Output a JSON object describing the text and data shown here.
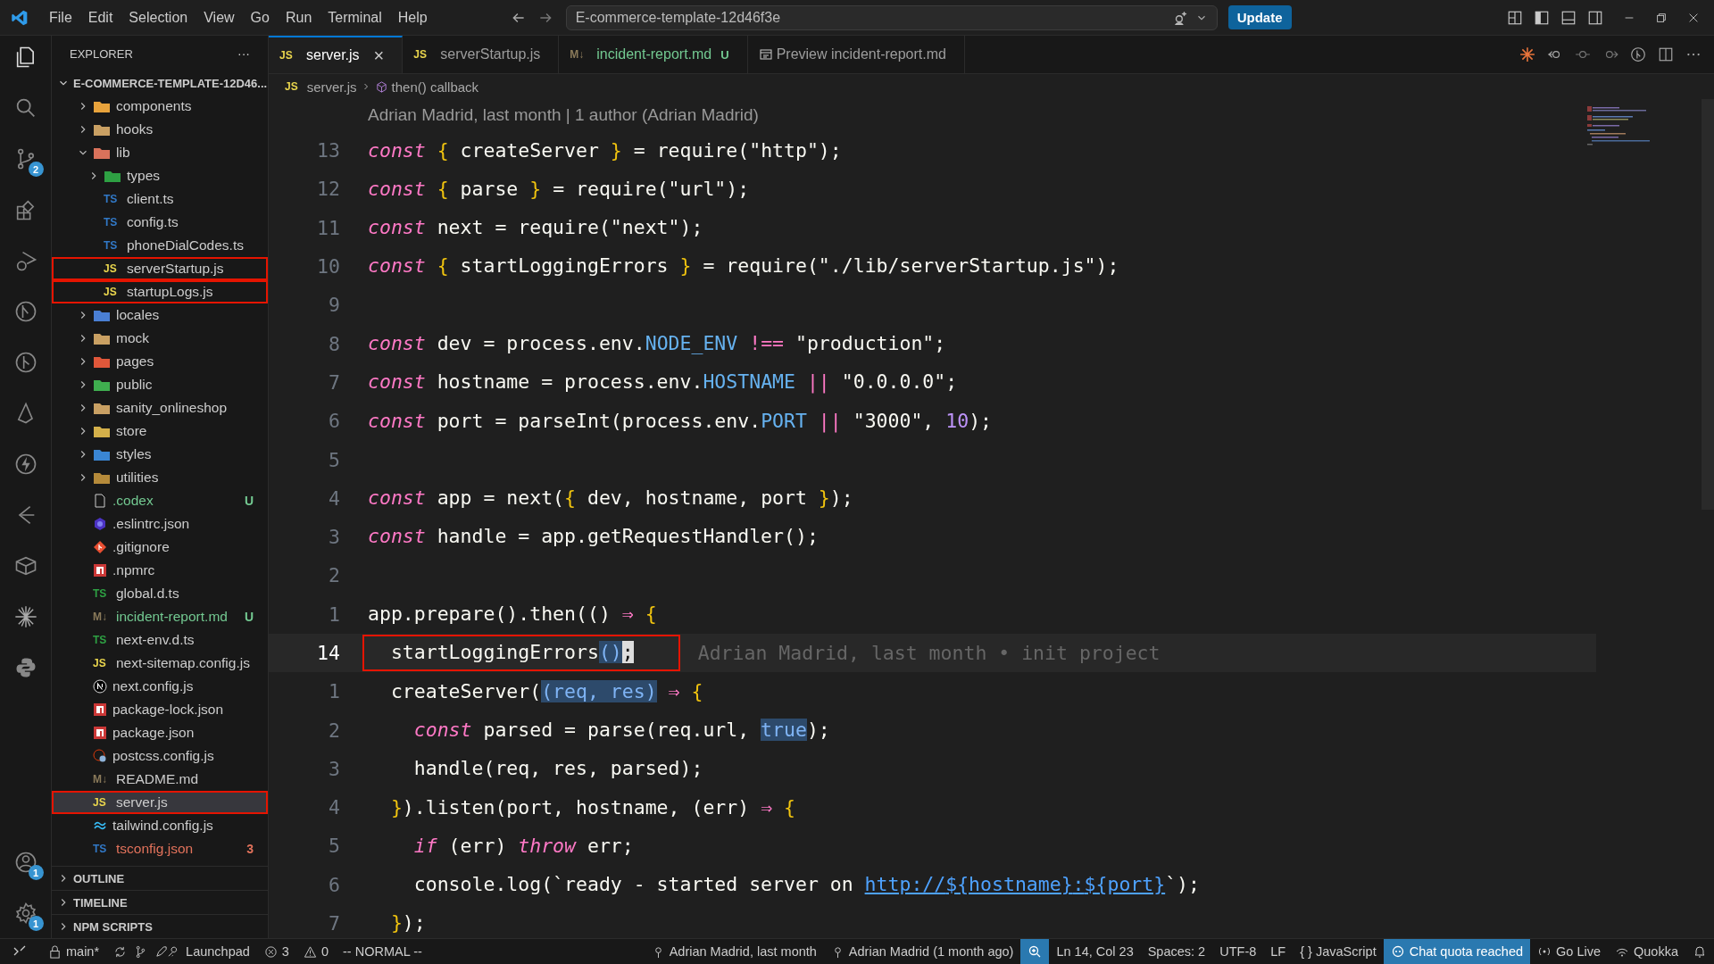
{
  "menu": [
    "File",
    "Edit",
    "Selection",
    "View",
    "Go",
    "Run",
    "Terminal",
    "Help"
  ],
  "command_center": {
    "value": "E-commerce-template-12d46f3e"
  },
  "update_button": "Update",
  "activity_bar": {
    "source_control_badge": "2",
    "accounts_badge": "1",
    "settings_badge": "1"
  },
  "explorer": {
    "title": "EXPLORER",
    "more": "···",
    "root": "E-COMMERCE-TEMPLATE-12D46...",
    "tree": [
      {
        "name": "components",
        "kind": "folder",
        "color": "#e8a33c",
        "expanded": false,
        "selected": false,
        "highlighted": false
      },
      {
        "name": "hooks",
        "kind": "folder",
        "color": "#c9a063",
        "expanded": false,
        "selected": false,
        "highlighted": false
      },
      {
        "name": "lib",
        "kind": "folder",
        "color": "#d9725b",
        "expanded": true,
        "selected": false,
        "highlighted": false,
        "children": [
          {
            "name": "types",
            "kind": "folder",
            "color": "#2ea043",
            "expanded": false,
            "selected": false,
            "highlighted": false
          },
          {
            "name": "client.ts",
            "kind": "ts",
            "icon": "TS",
            "selected": false,
            "highlighted": false
          },
          {
            "name": "config.ts",
            "kind": "ts",
            "icon": "TS",
            "selected": false,
            "highlighted": false
          },
          {
            "name": "phoneDialCodes.ts",
            "kind": "ts",
            "icon": "TS",
            "selected": false,
            "highlighted": false
          },
          {
            "name": "serverStartup.js",
            "kind": "js",
            "icon": "JS",
            "selected": false,
            "highlighted": true
          },
          {
            "name": "startupLogs.js",
            "kind": "js",
            "icon": "JS",
            "selected": false,
            "highlighted": true
          }
        ]
      },
      {
        "name": "locales",
        "kind": "folder",
        "color": "#4a7fd4",
        "expanded": false,
        "selected": false,
        "highlighted": false
      },
      {
        "name": "mock",
        "kind": "folder",
        "color": "#c9a063",
        "expanded": false,
        "selected": false,
        "highlighted": false
      },
      {
        "name": "pages",
        "kind": "folder",
        "color": "#e0573a",
        "expanded": false,
        "selected": false,
        "highlighted": false
      },
      {
        "name": "public",
        "kind": "folder",
        "color": "#3fae4f",
        "expanded": false,
        "selected": false,
        "highlighted": false
      },
      {
        "name": "sanity_onlineshop",
        "kind": "folder",
        "color": "#c9a063",
        "expanded": false,
        "selected": false,
        "highlighted": false
      },
      {
        "name": "store",
        "kind": "folder",
        "color": "#d4b04a",
        "expanded": false,
        "selected": false,
        "highlighted": false
      },
      {
        "name": "styles",
        "kind": "folder",
        "color": "#3a86d4",
        "expanded": false,
        "selected": false,
        "highlighted": false
      },
      {
        "name": "utilities",
        "kind": "folder",
        "color": "#b58a3a",
        "expanded": false,
        "selected": false,
        "highlighted": false
      },
      {
        "name": ".codex",
        "kind": "file",
        "status": "U",
        "color": "#73c991",
        "selected": false,
        "highlighted": false
      },
      {
        "name": ".eslintrc.json",
        "kind": "eslint",
        "selected": false,
        "highlighted": false
      },
      {
        "name": ".gitignore",
        "kind": "git",
        "selected": false,
        "highlighted": false
      },
      {
        "name": ".npmrc",
        "kind": "npm",
        "selected": false,
        "highlighted": false
      },
      {
        "name": "global.d.ts",
        "kind": "dts",
        "icon": "TS",
        "selected": false,
        "highlighted": false
      },
      {
        "name": "incident-report.md",
        "kind": "md",
        "icon": "M↓",
        "status": "U",
        "color": "#73c991",
        "selected": false,
        "highlighted": false
      },
      {
        "name": "next-env.d.ts",
        "kind": "dts",
        "icon": "TS",
        "selected": false,
        "highlighted": false
      },
      {
        "name": "next-sitemap.config.js",
        "kind": "js",
        "icon": "JS",
        "selected": false,
        "highlighted": false
      },
      {
        "name": "next.config.js",
        "kind": "next",
        "selected": false,
        "highlighted": false
      },
      {
        "name": "package-lock.json",
        "kind": "npm",
        "selected": false,
        "highlighted": false
      },
      {
        "name": "package.json",
        "kind": "npm",
        "selected": false,
        "highlighted": false
      },
      {
        "name": "postcss.config.js",
        "kind": "postcss",
        "selected": false,
        "highlighted": false
      },
      {
        "name": "README.md",
        "kind": "md",
        "icon": "M↓",
        "selected": false,
        "highlighted": false
      },
      {
        "name": "server.js",
        "kind": "js",
        "icon": "JS",
        "selected": true,
        "highlighted": true
      },
      {
        "name": "tailwind.config.js",
        "kind": "tailwind",
        "selected": false,
        "highlighted": false
      },
      {
        "name": "tsconfig.json",
        "kind": "tsconfig",
        "icon": "TS",
        "status": "3",
        "color": "#e2725b",
        "selected": false,
        "highlighted": false
      }
    ],
    "sections": [
      "OUTLINE",
      "TIMELINE",
      "NPM SCRIPTS"
    ]
  },
  "tabs": [
    {
      "label": "server.js",
      "kind": "js",
      "icon": "JS",
      "selected": true,
      "close": "×"
    },
    {
      "label": "serverStartup.js",
      "kind": "js",
      "icon": "JS",
      "selected": false
    },
    {
      "label": "incident-report.md",
      "kind": "md",
      "icon": "M↓",
      "status": "U",
      "selected": false
    },
    {
      "label": "Preview incident-report.md",
      "kind": "preview",
      "selected": false
    }
  ],
  "breadcrumbs": [
    {
      "label": "server.js",
      "icon": "JS"
    },
    {
      "label": "then() callback"
    }
  ],
  "blame_header": "Adrian Madrid, last month | 1 author (Adrian Madrid)",
  "code": [
    {
      "number": "13",
      "current": false,
      "highlighted": false,
      "tokens": [
        {
          "kind": "kw",
          "text": "const"
        },
        {
          "kind": "br",
          "text": " {"
        },
        {
          "kind": "t",
          "text": " createServer "
        },
        {
          "kind": "br",
          "text": "}"
        },
        {
          "kind": "t",
          "text": " = require("
        },
        {
          "kind": "s",
          "text": "\"http\""
        },
        {
          "kind": "t",
          "text": ");"
        }
      ]
    },
    {
      "number": "12",
      "current": false,
      "highlighted": false,
      "tokens": [
        {
          "kind": "kw",
          "text": "const"
        },
        {
          "kind": "br",
          "text": " {"
        },
        {
          "kind": "t",
          "text": " parse "
        },
        {
          "kind": "br",
          "text": "}"
        },
        {
          "kind": "t",
          "text": " = require("
        },
        {
          "kind": "s",
          "text": "\"url\""
        },
        {
          "kind": "t",
          "text": ");"
        }
      ]
    },
    {
      "number": "11",
      "current": false,
      "highlighted": false,
      "tokens": [
        {
          "kind": "kw",
          "text": "const"
        },
        {
          "kind": "t",
          "text": " next = require("
        },
        {
          "kind": "s",
          "text": "\"next\""
        },
        {
          "kind": "t",
          "text": ");"
        }
      ]
    },
    {
      "number": "10",
      "current": false,
      "highlighted": false,
      "tokens": [
        {
          "kind": "kw",
          "text": "const"
        },
        {
          "kind": "br",
          "text": " {"
        },
        {
          "kind": "t",
          "text": " startLoggingErrors "
        },
        {
          "kind": "br",
          "text": "}"
        },
        {
          "kind": "t",
          "text": " = require("
        },
        {
          "kind": "s",
          "text": "\"./lib/serverStartup.js\""
        },
        {
          "kind": "t",
          "text": ");"
        }
      ]
    },
    {
      "number": "9",
      "current": false,
      "highlighted": false
    },
    {
      "number": "8",
      "current": false,
      "highlighted": false,
      "tokens": [
        {
          "kind": "kw",
          "text": "const"
        },
        {
          "kind": "t",
          "text": " dev = process.env."
        },
        {
          "kind": "p",
          "text": "NODE_ENV"
        },
        {
          "kind": "op",
          "text": " !=="
        },
        {
          "kind": "s",
          "text": " \"production\""
        },
        {
          "kind": "t",
          "text": ";"
        }
      ]
    },
    {
      "number": "7",
      "current": false,
      "highlighted": false,
      "tokens": [
        {
          "kind": "kw",
          "text": "const"
        },
        {
          "kind": "t",
          "text": " hostname = process.env."
        },
        {
          "kind": "p",
          "text": "HOSTNAME"
        },
        {
          "kind": "op",
          "text": " ||"
        },
        {
          "kind": "s",
          "text": " \"0.0.0.0\""
        },
        {
          "kind": "t",
          "text": ";"
        }
      ]
    },
    {
      "number": "6",
      "current": false,
      "highlighted": false,
      "tokens": [
        {
          "kind": "kw",
          "text": "const"
        },
        {
          "kind": "t",
          "text": " port = parseInt(process.env."
        },
        {
          "kind": "p",
          "text": "PORT"
        },
        {
          "kind": "op",
          "text": " ||"
        },
        {
          "kind": "s",
          "text": " \"3000\""
        },
        {
          "kind": "t",
          "text": ", "
        },
        {
          "kind": "n",
          "text": "10"
        },
        {
          "kind": "t",
          "text": ");"
        }
      ]
    },
    {
      "number": "5",
      "current": false,
      "highlighted": false
    },
    {
      "number": "4",
      "current": false,
      "highlighted": false,
      "tokens": [
        {
          "kind": "kw",
          "text": "const"
        },
        {
          "kind": "t",
          "text": " app = next("
        },
        {
          "kind": "br",
          "text": "{"
        },
        {
          "kind": "t",
          "text": " dev, hostname, port "
        },
        {
          "kind": "br",
          "text": "}"
        },
        {
          "kind": "t",
          "text": ");"
        }
      ]
    },
    {
      "number": "3",
      "current": false,
      "highlighted": false,
      "tokens": [
        {
          "kind": "kw",
          "text": "const"
        },
        {
          "kind": "t",
          "text": " handle = app.getRequestHandler();"
        }
      ]
    },
    {
      "number": "2",
      "current": false,
      "highlighted": false
    },
    {
      "number": "1",
      "current": false,
      "highlighted": false,
      "tokens": [
        {
          "kind": "t",
          "text": "app.prepare().then(() "
        },
        {
          "kind": "op",
          "text": "⇒"
        },
        {
          "kind": "br",
          "text": " {"
        }
      ]
    },
    {
      "number": "14",
      "current": true,
      "highlighted": true,
      "blame": "Adrian Madrid, last month • init project",
      "tokens": [
        {
          "kind": "t",
          "text": "  startLoggingErrors"
        },
        {
          "kind": "m",
          "text": "()"
        },
        {
          "kind": "c",
          "text": ";"
        }
      ]
    },
    {
      "number": "1",
      "current": false,
      "highlighted": false,
      "tokens": [
        {
          "kind": "t",
          "text": "  createServer("
        },
        {
          "kind": "m",
          "text": "(req, res)"
        },
        {
          "kind": "op",
          "text": " ⇒"
        },
        {
          "kind": "br",
          "text": " {"
        }
      ]
    },
    {
      "number": "2",
      "current": false,
      "highlighted": false,
      "tokens": [
        {
          "kind": "kw",
          "text": "    const"
        },
        {
          "kind": "t",
          "text": " parsed = parse(req.url, "
        },
        {
          "kind": "m",
          "text": "true"
        },
        {
          "kind": "t",
          "text": ");"
        }
      ]
    },
    {
      "number": "3",
      "current": false,
      "highlighted": false,
      "tokens": [
        {
          "kind": "t",
          "text": "    handle(req, res, parsed);"
        }
      ]
    },
    {
      "number": "4",
      "current": false,
      "highlighted": false,
      "tokens": [
        {
          "kind": "br",
          "text": "  }"
        },
        {
          "kind": "t",
          "text": ").listen(port, hostname, (err) "
        },
        {
          "kind": "op",
          "text": "⇒"
        },
        {
          "kind": "br",
          "text": " {"
        }
      ]
    },
    {
      "number": "5",
      "current": false,
      "highlighted": false,
      "tokens": [
        {
          "kind": "kw",
          "text": "    if"
        },
        {
          "kind": "t",
          "text": " (err) "
        },
        {
          "kind": "kw",
          "text": "throw"
        },
        {
          "kind": "t",
          "text": " err;"
        }
      ]
    },
    {
      "number": "6",
      "current": false,
      "highlighted": false,
      "tokens": [
        {
          "kind": "t",
          "text": "    console.log(`ready - started server on "
        },
        {
          "kind": "l",
          "text": "http://"
        },
        {
          "kind": "lp",
          "text": "${hostname}"
        },
        {
          "kind": "l",
          "text": ":"
        },
        {
          "kind": "lp",
          "text": "${port}"
        },
        {
          "kind": "t",
          "text": "`);"
        }
      ]
    },
    {
      "number": "7",
      "current": false,
      "highlighted": false,
      "tokens": [
        {
          "kind": "br",
          "text": "  }"
        },
        {
          "kind": "t",
          "text": ");"
        }
      ]
    }
  ],
  "status_bar": {
    "left": [
      {
        "text": "main*",
        "kind": "branch"
      },
      {
        "kind": "sync"
      },
      {
        "text": "Launchpad",
        "kind": "launchpad"
      },
      {
        "text": "3",
        "kind": "errors"
      },
      {
        "text": "0",
        "kind": "warnings"
      },
      {
        "text": "-- NORMAL --",
        "kind": "plain"
      }
    ],
    "center": [
      {
        "text": "Adrian Madrid, last month",
        "kind": "commit"
      },
      {
        "text": "Adrian Madrid (1 month ago)",
        "kind": "commit"
      }
    ],
    "right": [
      {
        "kind": "zoom",
        "highlighted": true
      },
      {
        "text": "Ln 14, Col 23",
        "kind": "plain",
        "highlighted": false
      },
      {
        "text": "Spaces: 2",
        "kind": "plain",
        "highlighted": false
      },
      {
        "text": "UTF-8",
        "kind": "plain",
        "highlighted": false
      },
      {
        "text": "LF",
        "kind": "plain",
        "highlighted": false
      },
      {
        "text": "{ } JavaScript",
        "kind": "plain",
        "highlighted": false
      },
      {
        "text": "Chat quota reached",
        "kind": "chat",
        "highlighted": true
      },
      {
        "text": "Go Live",
        "kind": "live",
        "highlighted": false
      },
      {
        "text": "Quokka",
        "kind": "quokka",
        "highlighted": false
      },
      {
        "kind": "bell",
        "highlighted": false
      }
    ]
  }
}
